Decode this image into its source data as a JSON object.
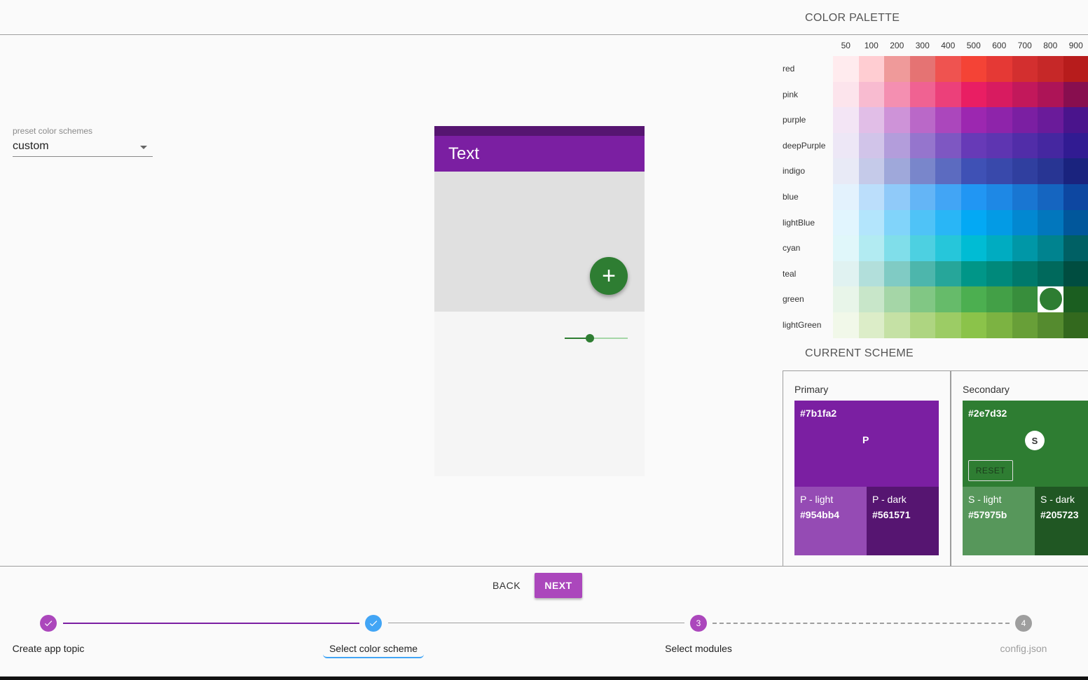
{
  "preset": {
    "label": "preset color schemes",
    "value": "custom"
  },
  "preview": {
    "appbar_title": "Text",
    "fab_icon": "plus-icon",
    "slider_value": 0.4,
    "colors": {
      "status_bar": "#561571",
      "app_bar": "#7b1fa2",
      "accent": "#2e7d32"
    }
  },
  "palette": {
    "title": "COLOR PALETTE",
    "shades": [
      "50",
      "100",
      "200",
      "300",
      "400",
      "500",
      "600",
      "700",
      "800",
      "900"
    ],
    "rows": [
      {
        "name": "red",
        "colors": [
          "#ffebee",
          "#ffcdd2",
          "#ef9a9a",
          "#e57373",
          "#ef5350",
          "#f44336",
          "#e53935",
          "#d32f2f",
          "#c62828",
          "#b71c1c"
        ]
      },
      {
        "name": "pink",
        "colors": [
          "#fce4ec",
          "#f8bbd0",
          "#f48fb1",
          "#f06292",
          "#ec407a",
          "#e91e63",
          "#d81b60",
          "#c2185b",
          "#ad1457",
          "#880e4f"
        ]
      },
      {
        "name": "purple",
        "colors": [
          "#f3e5f5",
          "#e1bee7",
          "#ce93d8",
          "#ba68c8",
          "#ab47bc",
          "#9c27b0",
          "#8e24aa",
          "#7b1fa2",
          "#6a1b9a",
          "#4a148c"
        ]
      },
      {
        "name": "deepPurple",
        "colors": [
          "#ede7f6",
          "#d1c4e9",
          "#b39ddb",
          "#9575cd",
          "#7e57c2",
          "#673ab7",
          "#5e35b1",
          "#512da8",
          "#4527a0",
          "#311b92"
        ]
      },
      {
        "name": "indigo",
        "colors": [
          "#e8eaf6",
          "#c5cae9",
          "#9fa8da",
          "#7986cb",
          "#5c6bc0",
          "#3f51b5",
          "#3949ab",
          "#303f9f",
          "#283593",
          "#1a237e"
        ]
      },
      {
        "name": "blue",
        "colors": [
          "#e3f2fd",
          "#bbdefb",
          "#90caf9",
          "#64b5f6",
          "#42a5f5",
          "#2196f3",
          "#1e88e5",
          "#1976d2",
          "#1565c0",
          "#0d47a1"
        ]
      },
      {
        "name": "lightBlue",
        "colors": [
          "#e1f5fe",
          "#b3e5fc",
          "#81d4fa",
          "#4fc3f7",
          "#29b6f6",
          "#03a9f4",
          "#039be5",
          "#0288d1",
          "#0277bd",
          "#01579b"
        ]
      },
      {
        "name": "cyan",
        "colors": [
          "#e0f7fa",
          "#b2ebf2",
          "#80deea",
          "#4dd0e1",
          "#26c6da",
          "#00bcd4",
          "#00acc1",
          "#0097a7",
          "#00838f",
          "#006064"
        ]
      },
      {
        "name": "teal",
        "colors": [
          "#e0f2f1",
          "#b2dfdb",
          "#80cbc4",
          "#4db6ac",
          "#26a69a",
          "#009688",
          "#00897b",
          "#00796b",
          "#00695c",
          "#004d40"
        ]
      },
      {
        "name": "green",
        "colors": [
          "#e8f5e9",
          "#c8e6c9",
          "#a5d6a7",
          "#81c784",
          "#66bb6a",
          "#4caf50",
          "#43a047",
          "#388e3c",
          "#2e7d32",
          "#1b5e20"
        ]
      },
      {
        "name": "lightGreen",
        "colors": [
          "#f1f8e9",
          "#dcedc8",
          "#c5e1a5",
          "#aed581",
          "#9ccc65",
          "#8bc34a",
          "#7cb342",
          "#689f38",
          "#558b2f",
          "#33691e"
        ]
      }
    ],
    "selected": {
      "row": "green",
      "shade": "800"
    }
  },
  "scheme": {
    "title": "CURRENT SCHEME",
    "primary": {
      "title": "Primary",
      "main_hex": "#7b1fa2",
      "letter": "P",
      "light_label": "P - light",
      "light_hex": "#954bb4",
      "dark_label": "P - dark",
      "dark_hex": "#561571"
    },
    "secondary": {
      "title": "Secondary",
      "main_hex": "#2e7d32",
      "letter": "S",
      "reset_label": "RESET",
      "light_label": "S - light",
      "light_hex": "#57975b",
      "dark_label": "S - dark",
      "dark_hex": "#205723"
    }
  },
  "nav": {
    "back_label": "BACK",
    "next_label": "NEXT",
    "next_color": "#ab47bc"
  },
  "stepper": {
    "steps": [
      {
        "label": "Create app topic",
        "state": "done",
        "icon": "check-icon",
        "color": "#ab47bc"
      },
      {
        "label": "Select color scheme",
        "state": "active",
        "icon": "check-icon",
        "color": "#42a5f5"
      },
      {
        "label": "Select modules",
        "state": "todo",
        "number": "3",
        "color": "#ab47bc"
      },
      {
        "label": "config.json",
        "state": "disabled",
        "number": "4",
        "color": "#9e9e9e"
      }
    ],
    "completed_color": "#7b1fa2"
  }
}
